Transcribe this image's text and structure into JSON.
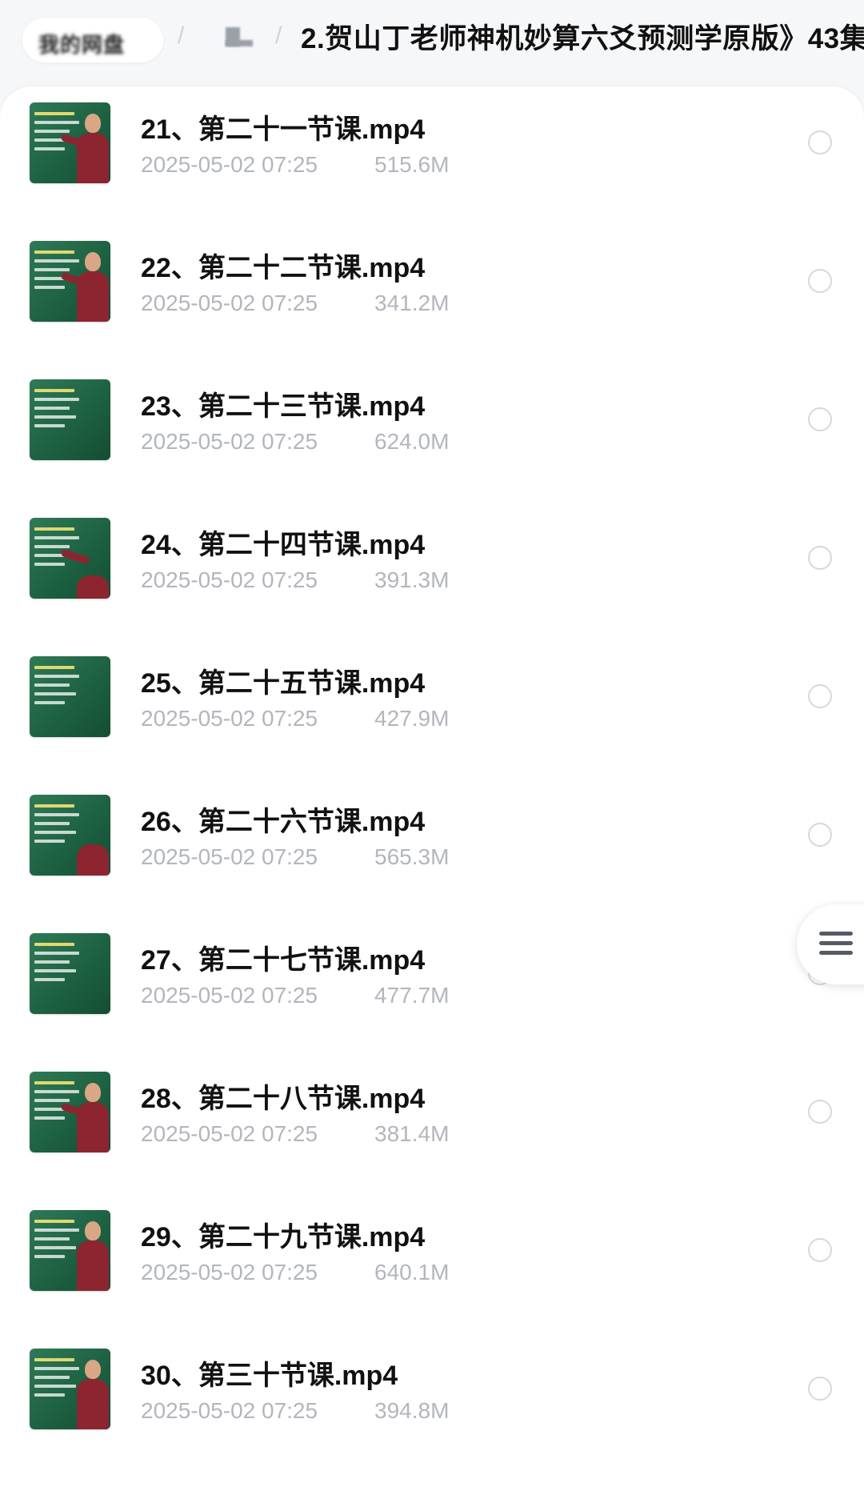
{
  "breadcrumb": {
    "root_label": "我的网盘",
    "current_folder": "2.贺山丁老师神机妙算六爻预测学原版》43集"
  },
  "files": [
    {
      "name": "21、第二十一节课.mp4",
      "date": "2025-05-02 07:25",
      "size": "515.6M"
    },
    {
      "name": "22、第二十二节课.mp4",
      "date": "2025-05-02 07:25",
      "size": "341.2M"
    },
    {
      "name": "23、第二十三节课.mp4",
      "date": "2025-05-02 07:25",
      "size": "624.0M"
    },
    {
      "name": "24、第二十四节课.mp4",
      "date": "2025-05-02 07:25",
      "size": "391.3M"
    },
    {
      "name": "25、第二十五节课.mp4",
      "date": "2025-05-02 07:25",
      "size": "427.9M"
    },
    {
      "name": "26、第二十六节课.mp4",
      "date": "2025-05-02 07:25",
      "size": "565.3M"
    },
    {
      "name": "27、第二十七节课.mp4",
      "date": "2025-05-02 07:25",
      "size": "477.7M"
    },
    {
      "name": "28、第二十八节课.mp4",
      "date": "2025-05-02 07:25",
      "size": "381.4M"
    },
    {
      "name": "29、第二十九节课.mp4",
      "date": "2025-05-02 07:25",
      "size": "640.1M"
    },
    {
      "name": "30、第三十节课.mp4",
      "date": "2025-05-02 07:25",
      "size": "394.8M"
    }
  ],
  "icons": {
    "thumbnail": "video-thumbnail",
    "select": "radio-circle-icon",
    "float_menu": "hamburger-menu-icon"
  },
  "colors": {
    "title_text": "#111111",
    "meta_text": "#b2b6bd",
    "radio_border": "#d5d8dd",
    "thumb_green": "#1d6142",
    "page_bg": "#f6f7f9"
  }
}
